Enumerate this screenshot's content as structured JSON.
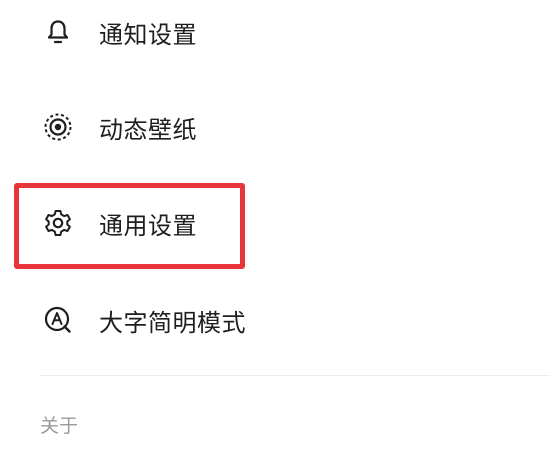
{
  "menu": {
    "items": [
      {
        "label": "通知设置",
        "icon": "bell-icon"
      },
      {
        "label": "动态壁纸",
        "icon": "live-wallpaper-icon"
      },
      {
        "label": "通用设置",
        "icon": "gear-icon",
        "highlighted": true
      },
      {
        "label": "大字简明模式",
        "icon": "large-font-icon"
      }
    ],
    "section_header": "关于"
  },
  "colors": {
    "highlight_border": "#e8353b",
    "text": "#1e1e1e",
    "muted_text": "#9a9a9a"
  }
}
